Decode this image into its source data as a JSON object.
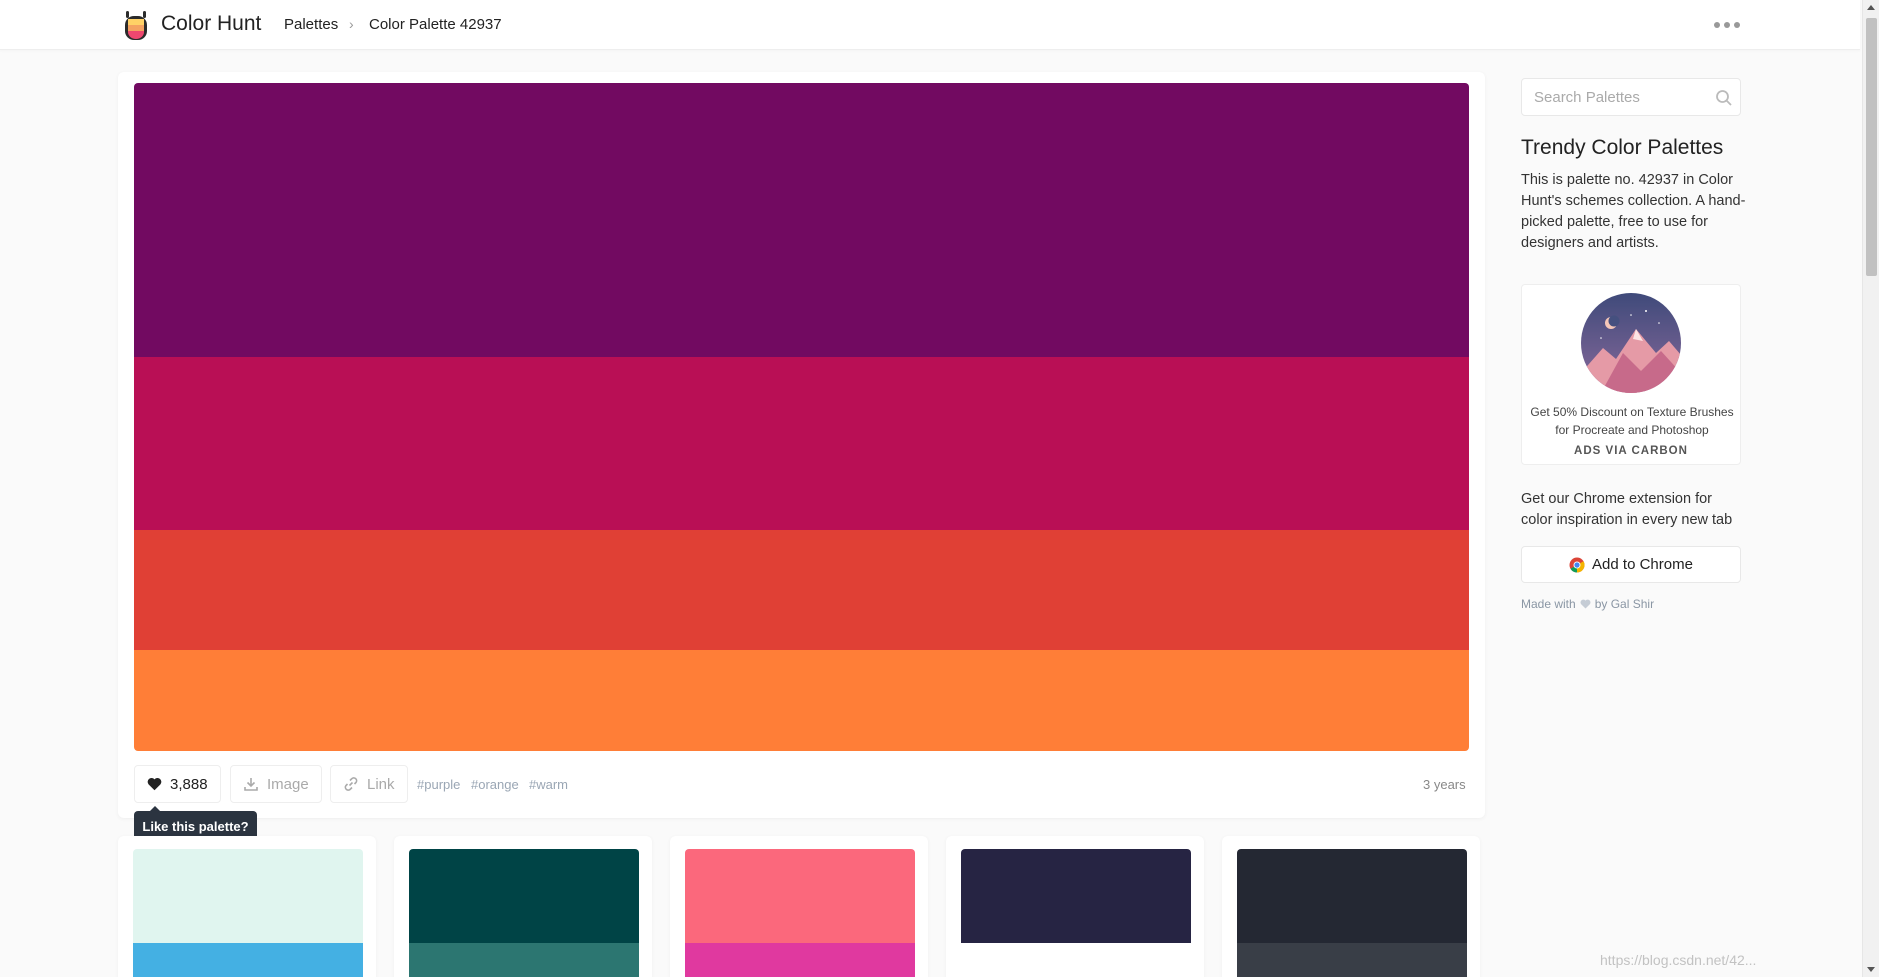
{
  "header": {
    "brand": "Color Hunt",
    "breadcrumb_root": "Palettes",
    "breadcrumb_sep": "›",
    "breadcrumb_current": "Color Palette 42937",
    "logo_icon": "color-hunt-logo-icon",
    "menu_icon": "more-dots-icon"
  },
  "palette": {
    "colors": [
      "#720a61",
      "#b90f55",
      "#e04035",
      "#ff7e37"
    ],
    "likes": "3,888",
    "image_label": "Image",
    "link_label": "Link",
    "tags": [
      "#purple",
      "#orange",
      "#warm"
    ],
    "age": "3 years",
    "tooltip": "Like this palette?"
  },
  "related_palettes": [
    {
      "colors": [
        "#e0f5ef",
        "#44b0e3"
      ]
    },
    {
      "colors": [
        "#004446",
        "#2c7671"
      ]
    },
    {
      "colors": [
        "#fb687c",
        "#e0399f"
      ]
    },
    {
      "colors": [
        "#262443",
        "#ffffff"
      ]
    },
    {
      "colors": [
        "#242833",
        "#393e47"
      ]
    }
  ],
  "sidebar": {
    "search_placeholder": "Search Palettes",
    "title": "Trendy Color Palettes",
    "description": "This is palette no. 42937 in Color Hunt's schemes collection. A hand-picked palette, free to use for designers and artists.",
    "ad_text": "Get 50% Discount on Texture Brushes for Procreate and Photoshop",
    "ad_via": "ADS VIA CARBON",
    "extension_text": "Get our Chrome extension for color inspiration in every new tab",
    "chrome_button": "Add to Chrome",
    "made_with": "Made with",
    "author": "by Gal Shir"
  },
  "watermark": "https://blog.csdn.net/42..."
}
